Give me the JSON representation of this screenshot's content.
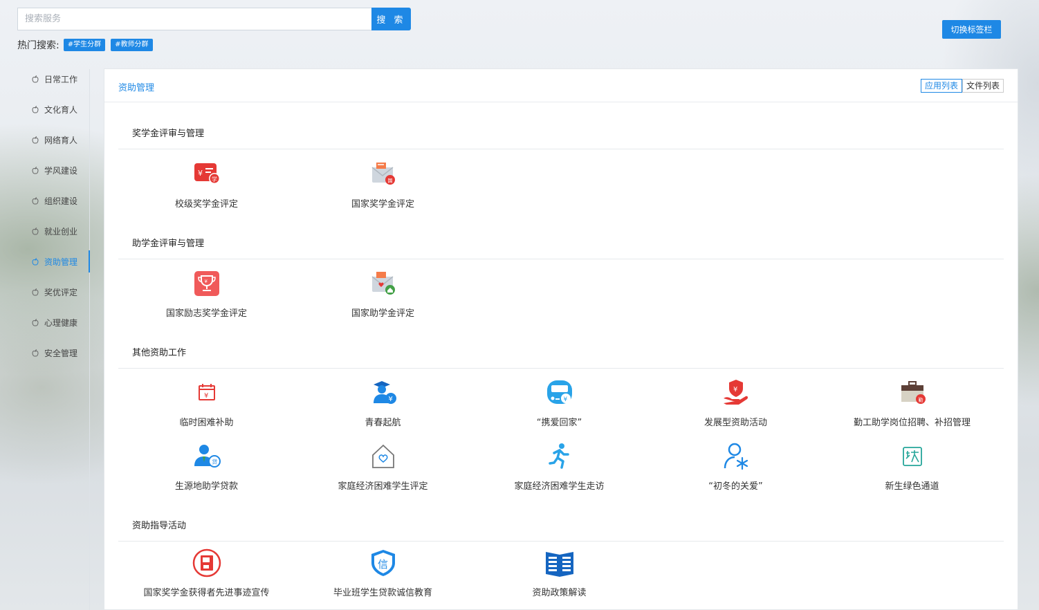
{
  "search": {
    "placeholder": "搜索服务",
    "button_label": "搜 索"
  },
  "hot_search": {
    "label": "热门搜索:",
    "tags": [
      "#学生分群",
      "#教师分群"
    ]
  },
  "switch_button": "切换标签栏",
  "sidebar": {
    "active": "资助管理",
    "items": [
      "日常工作",
      "文化育人",
      "网络育人",
      "学风建设",
      "组织建设",
      "就业创业",
      "资助管理",
      "奖优评定",
      "心理健康",
      "安全管理"
    ]
  },
  "panel": {
    "title": "资助管理",
    "view_toggle": [
      "应用列表",
      "文件列表"
    ],
    "active_view": "应用列表",
    "sections": [
      {
        "title": "奖学金评审与管理",
        "items": [
          {
            "label": "校级奖学金评定",
            "icon": "school-scholarship-icon"
          },
          {
            "label": "国家奖学金评定",
            "icon": "national-scholarship-icon"
          }
        ]
      },
      {
        "title": "助学金评审与管理",
        "items": [
          {
            "label": "国家励志奖学金评定",
            "icon": "trophy-icon"
          },
          {
            "label": "国家助学金评定",
            "icon": "national-grant-icon"
          }
        ]
      },
      {
        "title": "其他资助工作",
        "items": [
          {
            "label": "临时困难补助",
            "icon": "calendar-yuan-icon"
          },
          {
            "label": "青春起航",
            "icon": "graduate-yuan-icon"
          },
          {
            "label": "“携爱回家”",
            "icon": "bus-yuan-icon"
          },
          {
            "label": "发展型资助活动",
            "icon": "hand-shield-icon"
          },
          {
            "label": "勤工助学岗位招聘、补招管理",
            "icon": "briefcase-icon"
          },
          {
            "label": "生源地助学贷款",
            "icon": "person-loan-icon"
          },
          {
            "label": "家庭经济困难学生评定",
            "icon": "house-heart-icon"
          },
          {
            "label": "家庭经济困难学生走访",
            "icon": "running-person-icon"
          },
          {
            "label": "“初冬的关爱”",
            "icon": "person-snowflake-icon"
          },
          {
            "label": "新生绿色通道",
            "icon": "green-channel-icon"
          }
        ]
      },
      {
        "title": "资助指导活动",
        "items": [
          {
            "label": "国家奖学金获得者先进事迹宣传",
            "icon": "save-circle-icon"
          },
          {
            "label": "毕业班学生贷款诚信教育",
            "icon": "integrity-shield-icon"
          },
          {
            "label": "资助政策解读",
            "icon": "book-icon"
          }
        ]
      }
    ]
  },
  "colors": {
    "accent": "#1e88e5",
    "red": "#e53935",
    "green": "#43a047",
    "teal": "#26a69a"
  }
}
